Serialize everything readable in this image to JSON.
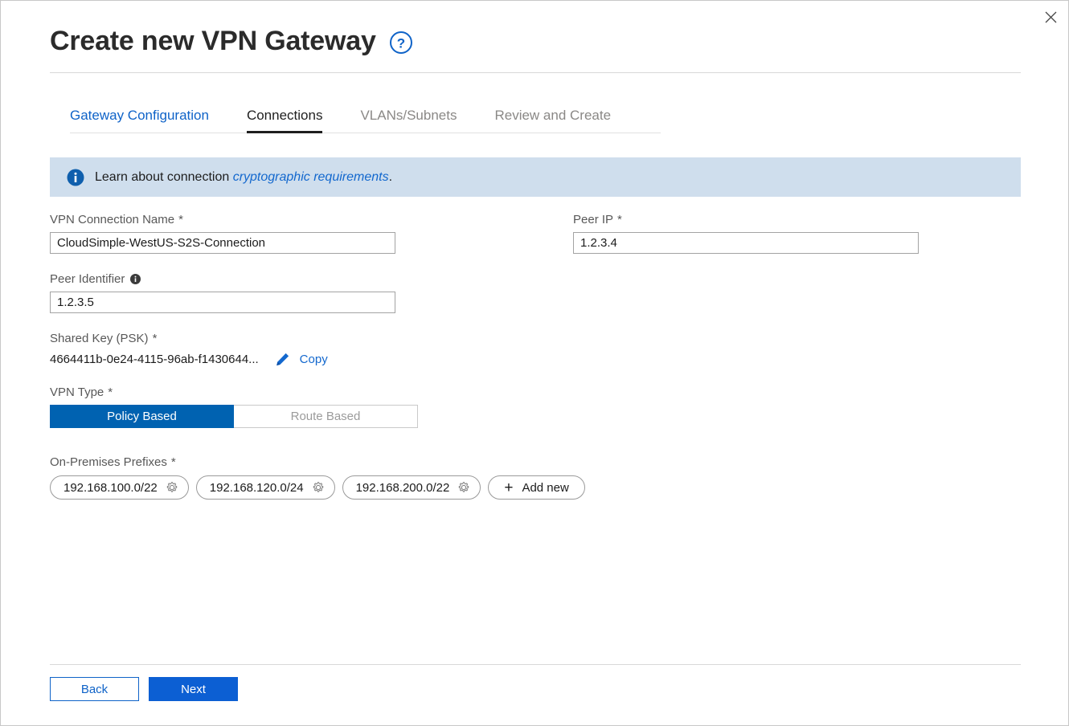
{
  "window": {
    "close_icon": "close-icon"
  },
  "header": {
    "title": "Create new VPN Gateway",
    "help_icon": "help-circle-icon"
  },
  "tabs": [
    {
      "label": "Gateway Configuration",
      "state": "link"
    },
    {
      "label": "Connections",
      "state": "active"
    },
    {
      "label": "VLANs/Subnets",
      "state": "inactive"
    },
    {
      "label": "Review and Create",
      "state": "inactive"
    }
  ],
  "info_banner": {
    "icon": "info-circle-icon",
    "text_before": "Learn about connection",
    "link_text": "cryptographic requirements",
    "text_after": "."
  },
  "form": {
    "connection_name": {
      "label": "VPN Connection Name",
      "required": "*",
      "value": "CloudSimple-WestUS-S2S-Connection",
      "placeholder": "VPN Connection Name"
    },
    "peer_ip": {
      "label": "Peer IP",
      "required": "*",
      "value": "1.2.3.4",
      "placeholder": "Peer IP"
    },
    "peer_identifier": {
      "label": "Peer Identifier",
      "info_icon": "info-dot-icon",
      "value": "1.2.3.5",
      "placeholder": "Peer Identifier"
    },
    "shared_key": {
      "label": "Shared Key  (PSK)",
      "required": "*",
      "value": "4664411b-0e24-4115-96ab-f1430644...",
      "edit_icon": "pencil-icon",
      "copy_label": "Copy"
    },
    "vpn_type": {
      "label": "VPN Type",
      "required": "*",
      "options": [
        {
          "label": "Policy Based",
          "selected": true
        },
        {
          "label": "Route Based",
          "selected": false
        }
      ]
    },
    "on_prem_prefixes": {
      "label": "On-Premises Prefixes",
      "required": "*",
      "chips": [
        {
          "label": "192.168.100.0/22",
          "icon": "gear-icon"
        },
        {
          "label": "192.168.120.0/24",
          "icon": "gear-icon"
        },
        {
          "label": "192.168.200.0/22",
          "icon": "gear-icon"
        }
      ],
      "add_new": {
        "plus": "+",
        "label": "Add new"
      }
    }
  },
  "footer": {
    "back_label": "Back",
    "next_label": "Next"
  },
  "colors": {
    "accent_blue": "#0f63c8",
    "primary_button": "#0c5fd3",
    "toggle_selected": "#0062b1",
    "info_banner_bg": "#cfdeed",
    "link_blue": "#1368ce"
  }
}
